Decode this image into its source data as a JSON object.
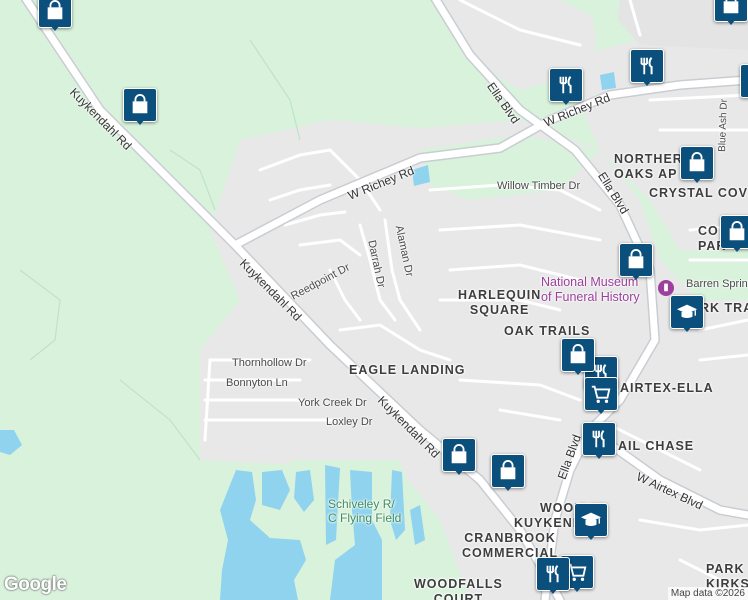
{
  "map": {
    "streets": {
      "w_richey_rd_1": "W Richey Rd",
      "w_richey_rd_2": "W Richey Rd",
      "ella_blvd_1": "Ella Blvd",
      "ella_blvd_2": "Ella Blvd",
      "ella_blvd_3": "Ella Blvd",
      "kuykendahl_rd_1": "Kuykendahl Rd",
      "kuykendahl_rd_2": "Kuykendahl Rd",
      "kuykendahl_rd_3": "Kuykendahl Rd",
      "willow_timber_dr": "Willow Timber Dr",
      "alaman_dr": "Alaman Dr",
      "darrah_dr": "Darrah Dr",
      "reedpoint_dr": "Reedpoint Dr",
      "thornhollow_dr": "Thornhollow Dr",
      "bonnyton_ln": "Bonnyton Ln",
      "york_creek_dr": "York Creek Dr",
      "loxley_dr": "Loxley Dr",
      "w_airtex_blvd": "W Airtex Blvd",
      "blue_ash_dr": "Blue Ash Dr",
      "barren_springs": "Barren Spring"
    },
    "neighborhoods": {
      "northern_oaks": [
        "NORTHER",
        "OAKS AP"
      ],
      "crystal_cove": "CRYSTAL COV",
      "harlequin_square": [
        "HARLEQUIN",
        "SQUARE"
      ],
      "oak_trails": "OAK TRAILS",
      "eagle_landing": "EAGLE LANDING",
      "airtex_ella": "AIRTEX-ELLA",
      "trail_chase": "AIL CHASE",
      "woods_kuykendahl": [
        "WOODS",
        "KUYKEND"
      ],
      "cranbrook": [
        "CRANBROOK",
        "COMMERCIAL"
      ],
      "woodfalls": [
        "WOODFALLS",
        "COURT"
      ],
      "park_kirkstall": [
        "PARK",
        "KIRKST"
      ],
      "co_park": [
        "CO",
        "PAR"
      ],
      "rk_trails": "RK TRA"
    },
    "parks": {
      "flying_field": [
        "Schiveley R/",
        "C Flying Field"
      ]
    },
    "pois": {
      "funeral_museum": [
        "National Museum",
        "of Funeral History"
      ]
    },
    "markers": [
      {
        "type": "shopping-bag"
      },
      {
        "type": "shopping-bag"
      },
      {
        "type": "shopping-bag"
      },
      {
        "type": "restaurant"
      },
      {
        "type": "restaurant"
      },
      {
        "type": "shopping-bag"
      },
      {
        "type": "shopping-bag"
      },
      {
        "type": "shopping-bag"
      },
      {
        "type": "school"
      },
      {
        "type": "shopping-bag"
      },
      {
        "type": "restaurant"
      },
      {
        "type": "grocery-cart"
      },
      {
        "type": "restaurant"
      },
      {
        "type": "shopping-bag"
      },
      {
        "type": "shopping-bag"
      },
      {
        "type": "school"
      },
      {
        "type": "restaurant"
      },
      {
        "type": "grocery-cart"
      }
    ],
    "logo": "Google",
    "attribution": "Map data ©2026"
  },
  "colors": {
    "land": "#e8e8e8",
    "greenery": "#d9f2dc",
    "water": "#8fd3ef",
    "road": "#ffffff",
    "arterial_casing": "#c9cdd2",
    "marker": "#0b4f7d"
  }
}
